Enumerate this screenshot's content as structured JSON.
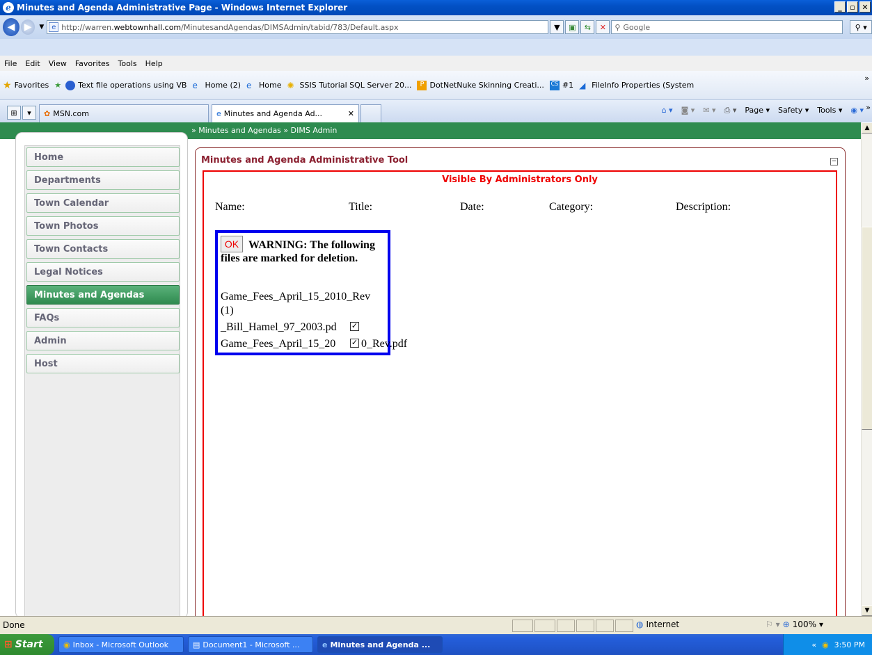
{
  "window": {
    "title": "Minutes and Agenda Administrative Page - Windows Internet Explorer"
  },
  "address": {
    "url_prefix": "http://warren.",
    "url_domain": "webtownhall.com",
    "url_path": "/MinutesandAgendas/DIMSAdmin/tabid/783/Default.aspx",
    "search_placeholder": "Google"
  },
  "menu": [
    "File",
    "Edit",
    "View",
    "Favorites",
    "Tools",
    "Help"
  ],
  "favorites": {
    "label": "Favorites",
    "items": [
      "Text file operations using VB",
      "Home (2)",
      "Home",
      "SSIS Tutorial SQL Server 20...",
      "DotNetNuke Skinning Creati...",
      "#1",
      "FileInfo Properties (System"
    ]
  },
  "tabs": {
    "quick_tab": "MSN.com",
    "active_tab": "Minutes and Agenda Ad...",
    "tools": [
      "Page ▾",
      "Safety ▾",
      "Tools ▾"
    ]
  },
  "page": {
    "breadcrumb": "» Minutes and Agendas » DIMS Admin",
    "nav": [
      "Home",
      "Departments",
      "Town Calendar",
      "Town Photos",
      "Town Contacts",
      "Legal Notices",
      "Minutes and Agendas",
      "FAQs",
      "Admin",
      "Host"
    ],
    "active_nav": "Minutes and Agendas",
    "module_title": "Minutes and Agenda Administrative Tool",
    "visible_note": "Visible By Administrators Only",
    "columns": [
      "Name:",
      "Title:",
      "Date:",
      "Category:",
      "Description:"
    ],
    "warning": {
      "ok_label": "OK",
      "message": "WARNING: The following files are marked for deletion.",
      "lines": [
        "Game_Fees_April_15_2010_Rev",
        "(1)",
        "_Bill_Hamel_97_2003.pd",
        "Game_Fees_April_15_20",
        "0_Rev.pdf"
      ]
    }
  },
  "status": {
    "text": "Done",
    "zone": "Internet",
    "zoom": "100%"
  },
  "taskbar": {
    "start": "Start",
    "tasks": [
      "Inbox - Microsoft Outlook",
      "Document1 - Microsoft ...",
      "Minutes and Agenda ..."
    ],
    "clock": "3:50 PM"
  }
}
